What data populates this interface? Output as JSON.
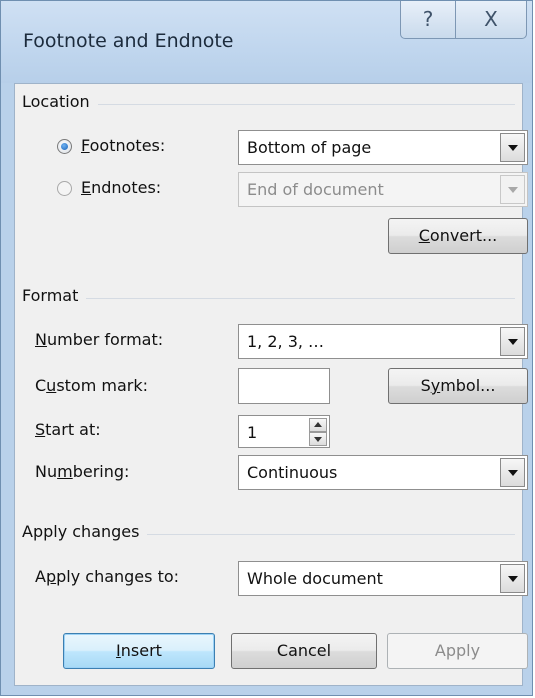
{
  "window": {
    "title": "Footnote and Endnote",
    "help_glyph": "?",
    "close_glyph": "X",
    "icons": {
      "help": "help-question-icon",
      "close": "close-x-icon"
    }
  },
  "location": {
    "group_label": "Location",
    "footnotes": {
      "mnemonic": "F",
      "rest": "ootnotes:",
      "value": "Bottom of page",
      "selected": true,
      "enabled": true
    },
    "endnotes": {
      "mnemonic": "E",
      "rest": "ndnotes:",
      "value": "End of document",
      "selected": false,
      "enabled": false
    },
    "convert_button": {
      "mnemonic": "C",
      "rest": "onvert..."
    }
  },
  "format": {
    "group_label": "Format",
    "number_format": {
      "mnemonic": "N",
      "rest": "umber format:",
      "value": "1, 2, 3, …"
    },
    "custom_mark": {
      "pre": "C",
      "mnemonic": "u",
      "rest": "stom mark:",
      "value": ""
    },
    "symbol_button": {
      "pre": "S",
      "mnemonic": "y",
      "rest": "mbol..."
    },
    "start_at": {
      "mnemonic": "S",
      "rest": "tart at:",
      "value": "1"
    },
    "numbering": {
      "pre": "Nu",
      "mnemonic": "m",
      "rest": "bering:",
      "value": "Continuous"
    }
  },
  "apply_changes": {
    "group_label": "Apply changes",
    "apply_to": {
      "pre": "A",
      "mnemonic": "p",
      "rest": "ply changes to:",
      "value": "Whole document"
    }
  },
  "buttons": {
    "insert": {
      "mnemonic": "I",
      "rest": "nsert",
      "is_default": true
    },
    "cancel": {
      "label": "Cancel"
    },
    "apply": {
      "label": "Apply",
      "enabled": false
    }
  },
  "colors": {
    "frame": "#b9d1ea",
    "client": "#f0f0f0",
    "default_button_border": "#3c7fb1",
    "radio_dot": "#1862b8"
  }
}
